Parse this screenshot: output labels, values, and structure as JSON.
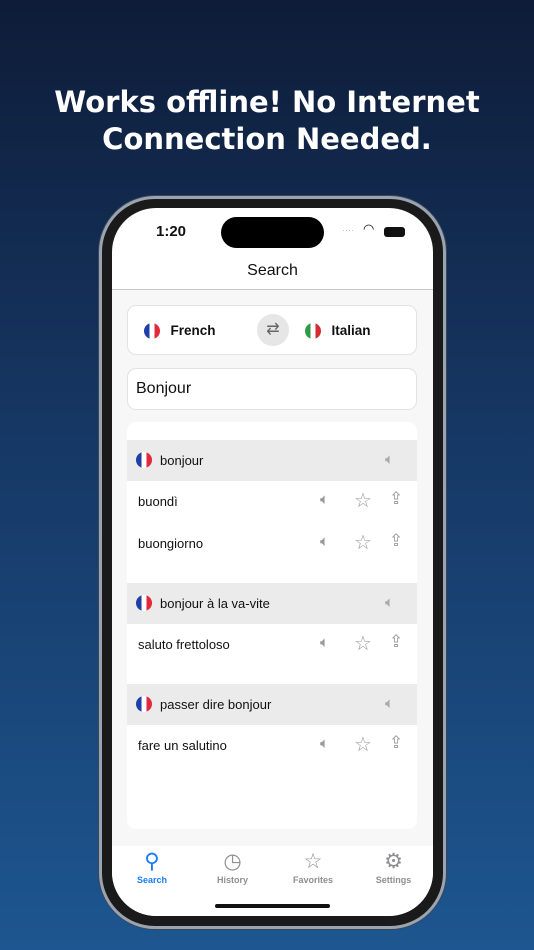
{
  "headline": {
    "line1": "Works offline! No Internet",
    "line2": "Connection Needed."
  },
  "status": {
    "time": "1:20"
  },
  "nav": {
    "title": "Search"
  },
  "languages": {
    "source": "French",
    "target": "Italian",
    "swap_icon": "arrows-swap-icon"
  },
  "search": {
    "value": "Bonjour"
  },
  "results": [
    {
      "term": "bonjour",
      "translations": [
        "buondì",
        "buongiorno"
      ]
    },
    {
      "term": "bonjour à la va-vite",
      "translations": [
        "saluto frettoloso"
      ]
    },
    {
      "term": "passer dire bonjour",
      "translations": [
        "fare un salutino"
      ]
    }
  ],
  "tabs": [
    {
      "label": "Search",
      "icon": "magnifier-icon",
      "active": true
    },
    {
      "label": "History",
      "icon": "clock-icon",
      "active": false
    },
    {
      "label": "Favorites",
      "icon": "star-icon",
      "active": false
    },
    {
      "label": "Settings",
      "icon": "gear-icon",
      "active": false
    }
  ],
  "colors": {
    "accent": "#1a7cf5",
    "inactive": "#8e8e93"
  }
}
